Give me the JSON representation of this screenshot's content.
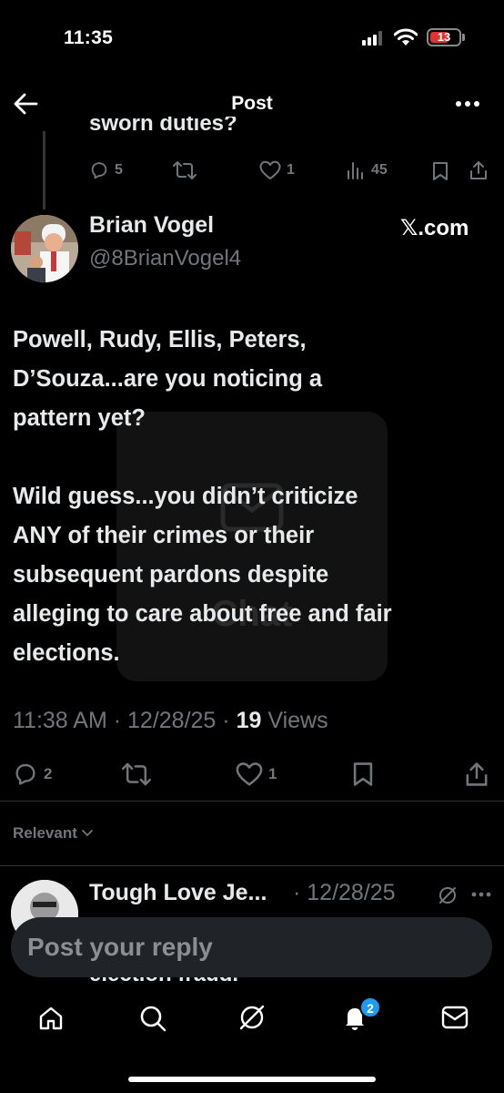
{
  "status_bar": {
    "time": "11:35",
    "battery": "13"
  },
  "header": {
    "title": "Post",
    "back_icon": "arrow-left-icon",
    "more_icon": "more-horizontal-icon"
  },
  "previous_post": {
    "text_fragment": "sworn duties?",
    "replies": "5",
    "likes": "1",
    "views": "45"
  },
  "post": {
    "author_name": "Brian Vogel",
    "author_handle": "@8BrianVogel4",
    "source": "𝕏.com",
    "body": "Powell, Rudy, Ellis, Peters,\nD’Souza...are you noticing a\npattern yet?\n\nWild guess...you didn’t criticize\nANY of their crimes or their\nsubsequent pardons despite\nalleging to care about free and fair\nelections.",
    "time": "11:38 AM",
    "date": "12/28/25",
    "views_count": "19",
    "views_label": "Views",
    "replies": "2",
    "likes": "1"
  },
  "watermark": {
    "text": "Chat"
  },
  "sort": {
    "label": "Relevant"
  },
  "reply": {
    "author_name": "Tough Love Je...",
    "date": "· 12/28/25",
    "peek_text": "election fraud."
  },
  "compose": {
    "placeholder": "Post your reply"
  },
  "tab_bar": {
    "notifications_badge": "2"
  },
  "colors": {
    "accent": "#1d9bf0",
    "muted": "#71767b",
    "text": "#e7e9ea",
    "battery_low": "#e0322f"
  }
}
